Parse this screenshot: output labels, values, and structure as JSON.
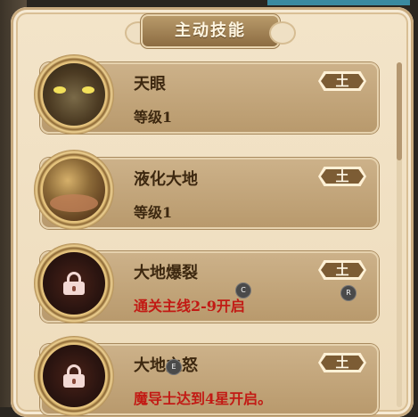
{
  "panel": {
    "title": "主动技能"
  },
  "skills": [
    {
      "name": "天眼",
      "detail": "等级1",
      "element": "土",
      "locked": false,
      "icon": "eye-skill-icon"
    },
    {
      "name": "液化大地",
      "detail": "等级1",
      "element": "土",
      "locked": false,
      "icon": "liquefy-earth-skill-icon"
    },
    {
      "name": "大地爆裂",
      "detail": "通关主线2-9开启",
      "element": "土",
      "locked": true,
      "icon": "lock-icon"
    },
    {
      "name": "大地之怒",
      "detail": "魔导士达到4星开启。",
      "element": "土",
      "locked": true,
      "icon": "lock-icon"
    }
  ],
  "hints": {
    "c": "C",
    "r": "R",
    "e": "E"
  },
  "colors": {
    "locked_text": "#c21a14",
    "badge_bg": "#7c5c34"
  }
}
